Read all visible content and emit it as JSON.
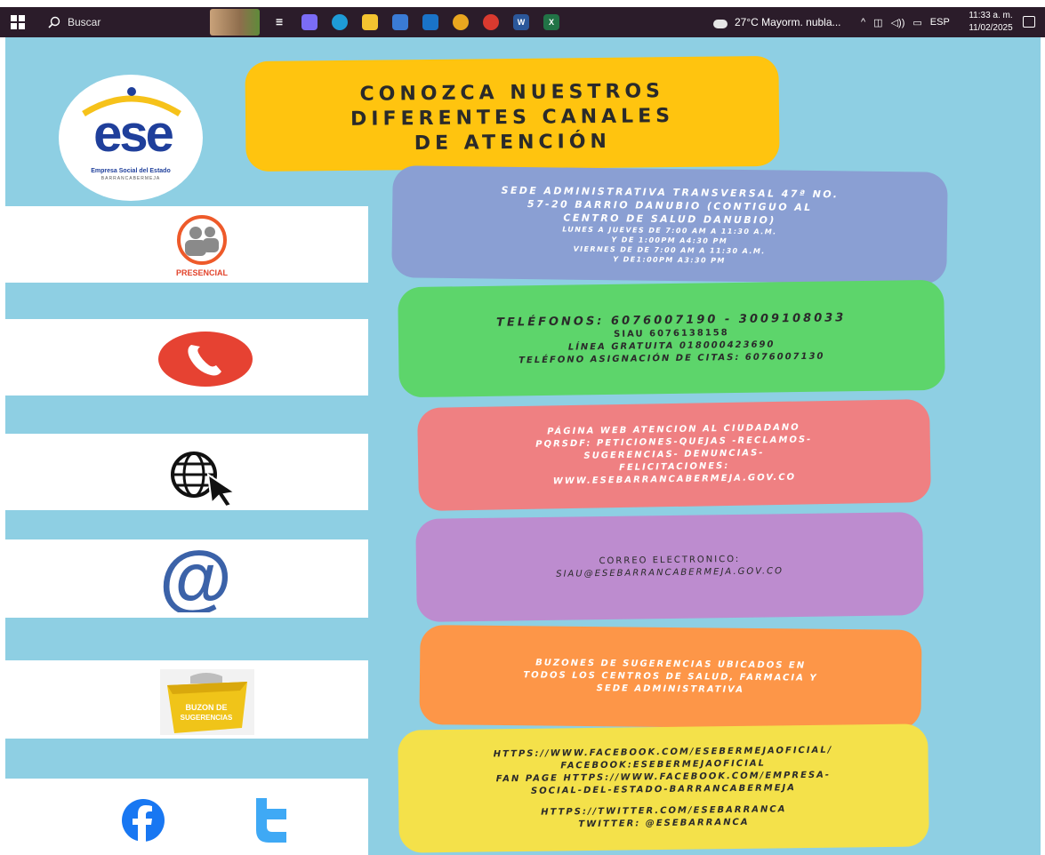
{
  "taskbar": {
    "search_placeholder": "Buscar",
    "apps": [
      {
        "name": "task-view-icon",
        "glyph": "☰",
        "color": "#2b1c2a"
      },
      {
        "name": "copilot-icon",
        "glyph": "",
        "color": "#7b6cf6"
      },
      {
        "name": "edge-icon",
        "glyph": "",
        "color": "#1e9bd7"
      },
      {
        "name": "file-explorer-icon",
        "glyph": "",
        "color": "#f4c430"
      },
      {
        "name": "store-icon",
        "glyph": "",
        "color": "#3a7bd5"
      },
      {
        "name": "mail-icon",
        "glyph": "",
        "color": "#1a73c8"
      },
      {
        "name": "chrome-icon",
        "glyph": "",
        "color": "#e9a61f"
      },
      {
        "name": "chrome-profile-icon",
        "glyph": "",
        "color": "#d93a2f"
      },
      {
        "name": "word-icon",
        "glyph": "W",
        "color": "#2b579a"
      },
      {
        "name": "excel-icon",
        "glyph": "X",
        "color": "#217346"
      }
    ],
    "weather": "27°C  Mayorm. nubla...",
    "language": "ESP",
    "time": "11:33 a. m.",
    "date": "11/02/2025"
  },
  "poster": {
    "logo": {
      "letters": "ese",
      "subtitle": "Empresa Social del Estado",
      "city": "BARRANCABERMEJA"
    },
    "title_lines": [
      "CONOZCA NUESTROS",
      "DIFERENTES CANALES",
      "DE ATENCIÓN"
    ],
    "channels": {
      "presencial": {
        "icon_label": "PRESENCIAL",
        "lines": [
          "SEDE ADMINISTRATIVA TRANSVERSAL 47ª NO.",
          "57-20 BARRIO DANUBIO (CONTIGUO AL",
          "CENTRO DE SALUD DANUBIO)",
          "LUNES A JUEVES DE 7:00 AM A  11:30 A.M.",
          "Y DE 1:00PM  A4:30 PM",
          "VIERNES DE DE 7:00 AM A 11:30 A.M.",
          "Y DE1:00PM  A3:30 PM"
        ]
      },
      "telefono": {
        "lines": [
          "TELÉFONOS: 6076007190 - 3009108033",
          "SIAU 6076138158",
          "LÍNEA GRATUITA 018000423690",
          "TELÉFONO ASIGNACIÓN DE CITAS: 6076007130"
        ]
      },
      "web": {
        "lines": [
          "PÁGINA WEB ATENCION AL CIUDADANO",
          "PQRSDF: PETICIONES-QUEJAS -RECLAMOS-",
          "SUGERENCIAS- DENUNCIAS-",
          "FELICITACIONES:",
          "WWW.ESEBARRANCABERMEJA.GOV.CO"
        ]
      },
      "correo": {
        "lines": [
          "CORREO ELECTRONICO:",
          "SIAU@ESEBARRANCABERMEJA.GOV.CO"
        ]
      },
      "buzon": {
        "icon_label_1": "BUZON DE",
        "icon_label_2": "SUGERENCIAS",
        "lines": [
          "BUZONES DE SUGERENCIAS UBICADOS EN",
          "TODOS LOS CENTROS DE SALUD, FARMACIA Y",
          "SEDE ADMINISTRATIVA"
        ]
      },
      "redes": {
        "lines": [
          "HTTPS://WWW.FACEBOOK.COM/ESEBERMEJAOFICIAL/",
          "FACEBOOK:ESEBERMEJAOFICIAL",
          "FAN PAGE HTTPS://WWW.FACEBOOK.COM/EMPRESA-",
          "SOCIAL-DEL-ESTADO-BARRANCABERMEJA",
          "",
          "HTTPS://TWITTER.COM/ESEBARRANCA",
          "TWITTER: @ESEBARRANCA"
        ]
      }
    },
    "colors": {
      "background": "#8ecfe3",
      "title": "#ffc40f",
      "presencial": "#8a9fd3",
      "telefono": "#5dd56b",
      "web": "#ef8082",
      "correo": "#bd8ccf",
      "buzon": "#fd9648",
      "redes": "#f4e14a"
    }
  }
}
